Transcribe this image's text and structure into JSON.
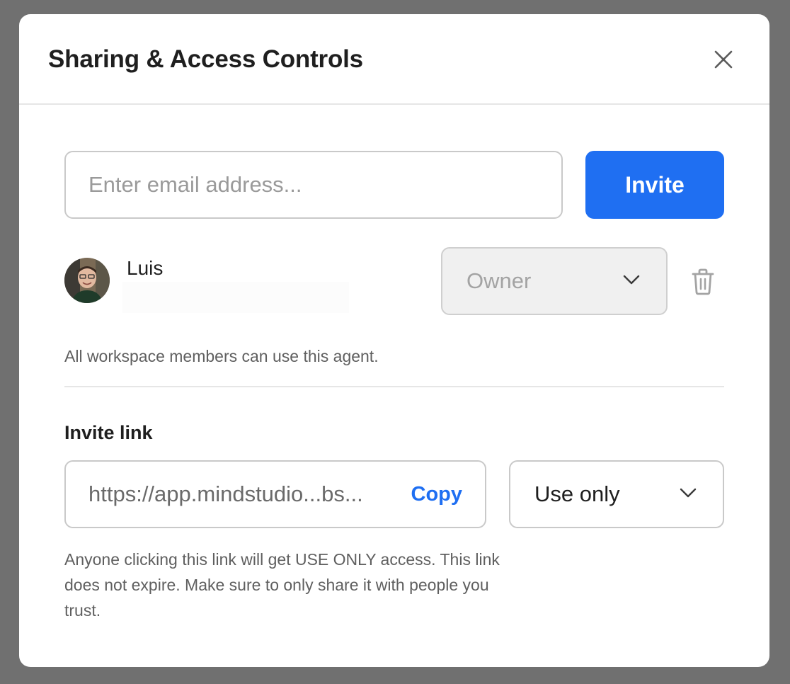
{
  "dialog": {
    "title": "Sharing & Access Controls",
    "close_icon": "close-icon"
  },
  "invite_form": {
    "email_placeholder": "Enter email address...",
    "email_value": "",
    "invite_label": "Invite"
  },
  "member": {
    "name": "Luis",
    "role": "Owner",
    "role_icon": "chevron-down-icon",
    "delete_icon": "trash-icon"
  },
  "workspace_note": "All workspace members can use this agent.",
  "invite_link": {
    "section_title": "Invite link",
    "url": "https://app.mindstudio...bs...",
    "copy_label": "Copy",
    "access_level": "Use only",
    "note": "Anyone clicking this link will get USE ONLY access. This link does not expire. Make sure to only share it with people you trust."
  },
  "colors": {
    "accent": "#1f6ff2",
    "backdrop": "#707070",
    "disabled_bg": "#f0f0f0"
  }
}
